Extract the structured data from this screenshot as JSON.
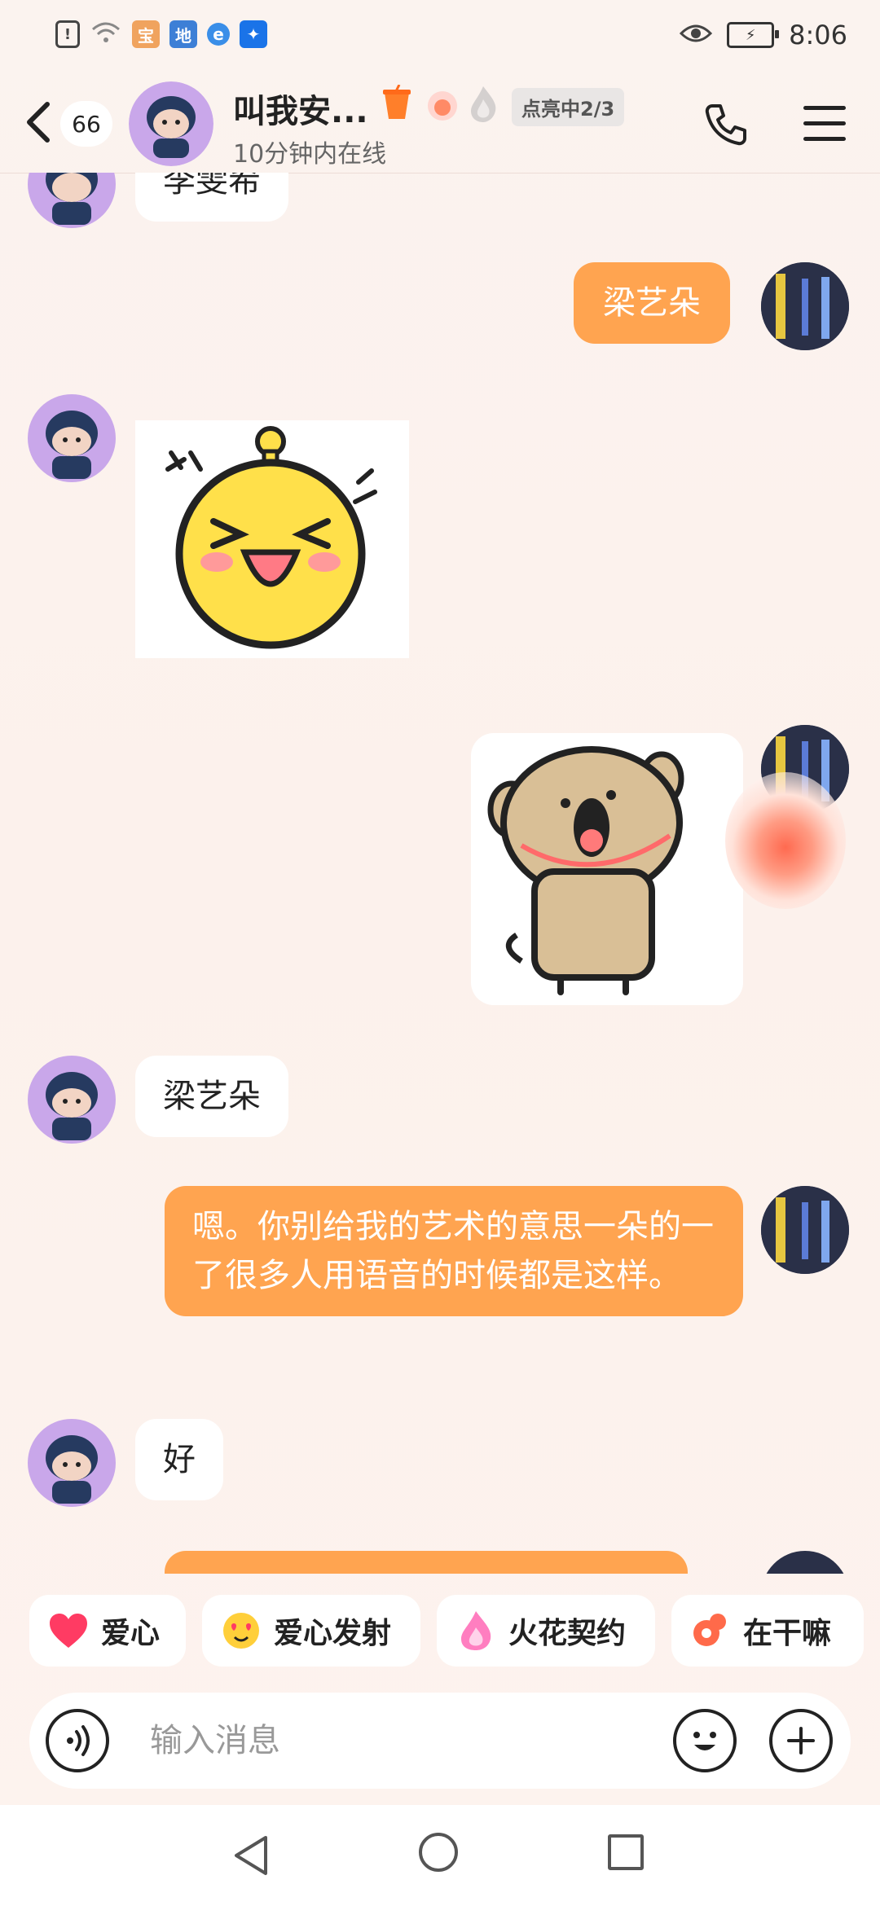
{
  "status_bar": {
    "time": "8:06",
    "battery_icon": "battery-charging-icon"
  },
  "header": {
    "unread_count": "66",
    "contact_name": "叫我安...",
    "online_status": "10分钟内在线",
    "light_badge": "点亮中2/3",
    "icons": [
      "back-icon",
      "phone-icon",
      "menu-icon"
    ]
  },
  "messages": [
    {
      "side": "left",
      "type": "text",
      "text": "李雯希"
    },
    {
      "side": "right",
      "type": "text",
      "text": "梁艺朵"
    },
    {
      "side": "left",
      "type": "sticker",
      "sticker": "laughing-yellow-face-sticker"
    },
    {
      "side": "right",
      "type": "sticker",
      "sticker": "shouting-bear-sticker"
    },
    {
      "side": "left",
      "type": "text",
      "text": "梁艺朵"
    },
    {
      "side": "right",
      "type": "text",
      "text": "嗯。你别给我的艺术的意思一朵的一了很多人用语音的时候都是这样。"
    },
    {
      "side": "left",
      "type": "text",
      "text": "好"
    }
  ],
  "quick_actions": [
    {
      "label": "爱心",
      "icon": "heart-icon"
    },
    {
      "label": "爱心发射",
      "icon": "heart-eyes-icon"
    },
    {
      "label": "火花契约",
      "icon": "flame-icon"
    },
    {
      "label": "在干嘛",
      "icon": "chat-bubbles-icon"
    }
  ],
  "input": {
    "placeholder": "输入消息",
    "value": ""
  },
  "colors": {
    "accent": "#ffa450",
    "background": "#fbf3ef"
  }
}
